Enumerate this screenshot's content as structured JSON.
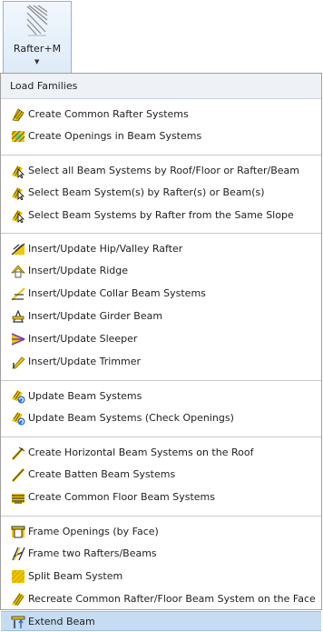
{
  "ribbon": {
    "button_label": "Rafter+M",
    "icon": "rafter-icon"
  },
  "menu": {
    "header": "Load Families",
    "items": [
      {
        "label": "Create Common Rafter Systems",
        "icon": "rafter-system-icon"
      },
      {
        "label": "Create Openings in Beam Systems",
        "icon": "opening-icon"
      },
      {
        "label": "Select all Beam Systems by Roof/Floor or Rafter/Beam",
        "icon": "select-beam-icon"
      },
      {
        "label": "Select Beam System(s) by Rafter(s) or Beam(s)",
        "icon": "select-beam-icon"
      },
      {
        "label": "Select Beam Systems by Rafter from the Same Slope",
        "icon": "select-beam-icon"
      },
      {
        "label": "Insert/Update Hip/Valley Rafter",
        "icon": "hip-valley-icon"
      },
      {
        "label": "Insert/Update Ridge",
        "icon": "ridge-icon"
      },
      {
        "label": "Insert/Update Collar Beam Systems",
        "icon": "collar-beam-icon"
      },
      {
        "label": "Insert/Update Girder Beam",
        "icon": "girder-icon"
      },
      {
        "label": "Insert/Update Sleeper",
        "icon": "sleeper-icon"
      },
      {
        "label": "Insert/Update Trimmer",
        "icon": "trimmer-icon"
      },
      {
        "label": "Update Beam Systems",
        "icon": "update-beam-icon"
      },
      {
        "label": "Update Beam Systems (Check Openings)",
        "icon": "update-beam-icon"
      },
      {
        "label": "Create Horizontal Beam Systems on the Roof",
        "icon": "horizontal-beam-icon"
      },
      {
        "label": "Create Batten Beam Systems",
        "icon": "batten-icon"
      },
      {
        "label": "Create Common Floor Beam Systems",
        "icon": "floor-beam-icon"
      },
      {
        "label": "Frame Openings (by Face)",
        "icon": "frame-opening-icon"
      },
      {
        "label": "Frame two Rafters/Beams",
        "icon": "frame-rafters-icon"
      },
      {
        "label": "Split Beam System",
        "icon": "split-beam-icon"
      },
      {
        "label": "Recreate Common Rafter/Floor Beam System on the Face",
        "icon": "recreate-icon"
      },
      {
        "label": "Extend Beam",
        "icon": "extend-beam-icon"
      }
    ]
  }
}
